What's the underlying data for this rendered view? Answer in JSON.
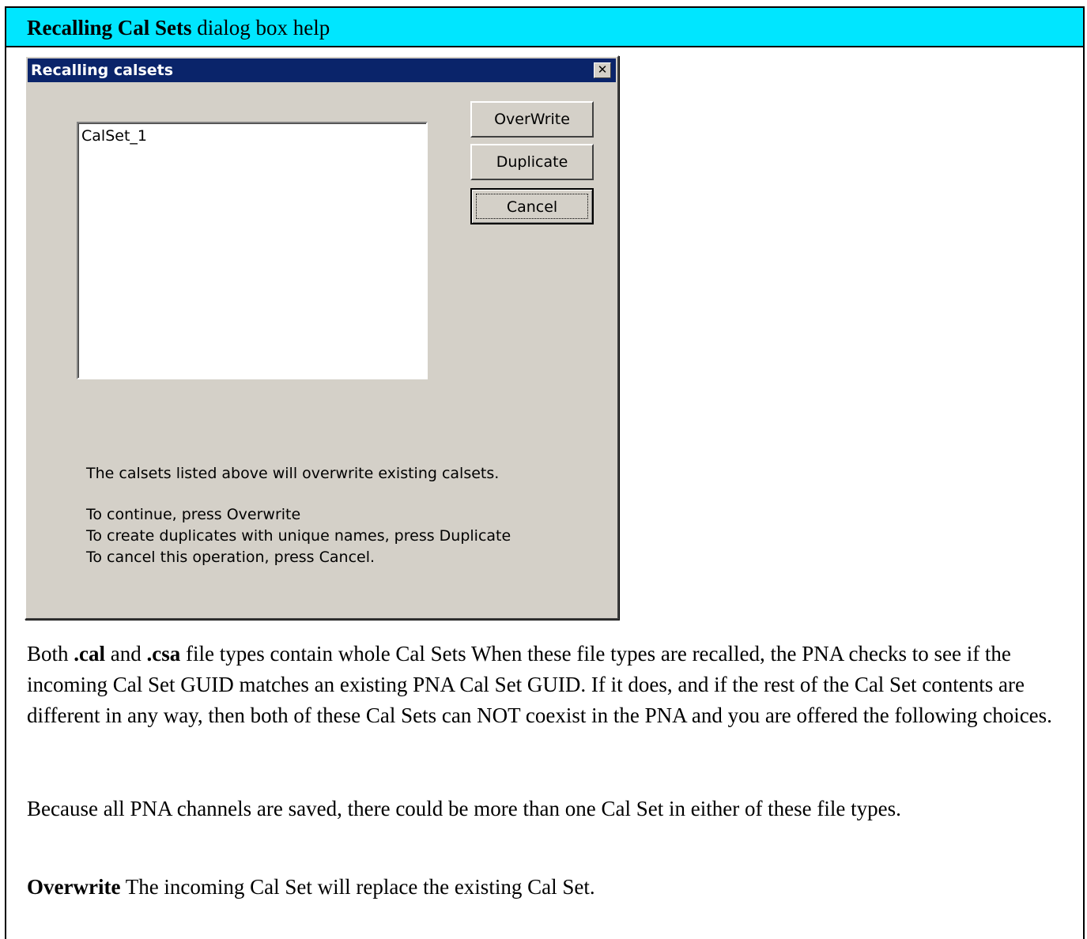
{
  "header": {
    "title_bold": "Recalling Cal Sets",
    "title_rest": " dialog box help"
  },
  "dialog": {
    "title": "Recalling calsets",
    "close_glyph": "✕",
    "list_items": [
      "CalSet_1"
    ],
    "buttons": {
      "overwrite": "OverWrite",
      "duplicate": "Duplicate",
      "cancel": "Cancel"
    },
    "message": "The calsets listed above will overwrite existing calsets.",
    "instructions": [
      "To continue, press Overwrite",
      "To create duplicates with unique names, press Duplicate",
      "To cancel this operation, press Cancel."
    ]
  },
  "body": {
    "p1": {
      "t1": "Both ",
      "b1": ".cal",
      "t2": " and ",
      "b2": ".csa",
      "t3": " file types contain whole Cal Sets  When these file types are recalled, the PNA checks to see if the incoming Cal Set GUID matches an existing PNA Cal Set GUID. If it does, and if the rest of the Cal Set contents are different in any way, then both of these Cal Sets can NOT coexist in the PNA and you are offered the following choices."
    },
    "p2": "Because all PNA channels are saved, there could be more than one Cal Set in either of these file types.",
    "p3": {
      "bold": "Overwrite",
      "rest": " The incoming Cal Set will replace the existing Cal Set."
    }
  }
}
